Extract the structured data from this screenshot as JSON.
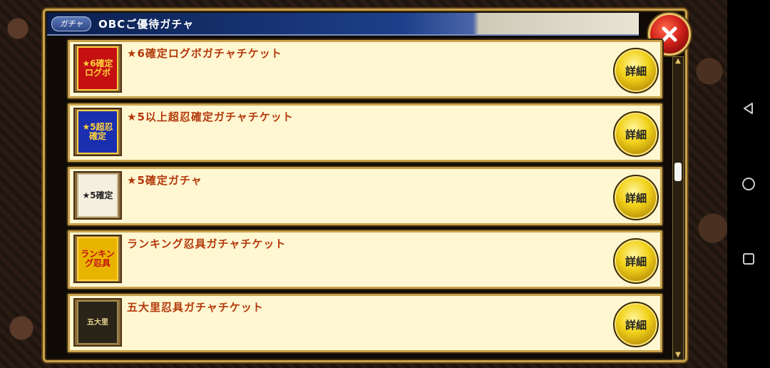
{
  "dialog": {
    "tag": "ガチャ",
    "title": "OBCご優待ガチャ"
  },
  "items": [
    {
      "label": "★6確定ログボガチャチケット",
      "thumb": "★6確定ログボ",
      "detail": "詳細"
    },
    {
      "label": "★5以上超忍確定ガチャチケット",
      "thumb": "★5超忍確定",
      "detail": "詳細"
    },
    {
      "label": "★5確定ガチャ",
      "thumb": "★5確定",
      "detail": "詳細"
    },
    {
      "label": "ランキング忍具ガチャチケット",
      "thumb": "ランキング忍具",
      "detail": "詳細"
    },
    {
      "label": "五大里忍具ガチャチケット",
      "thumb": "五大里",
      "detail": "詳細"
    }
  ],
  "colors": {
    "accent_gold": "#c9a24a",
    "label_red": "#b3380a",
    "title_blue": "#1d3f8a",
    "close_red": "#d2221b"
  },
  "icons": [
    "close-icon",
    "back-icon",
    "home-icon",
    "recent-apps-icon",
    "scroll-up-icon",
    "scroll-down-icon"
  ]
}
